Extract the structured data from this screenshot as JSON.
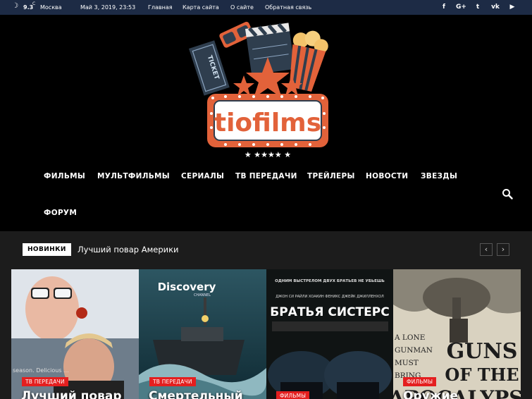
{
  "topbar": {
    "temperature": "9.3",
    "temp_unit": "C",
    "city": "Москва",
    "date": "Май 3, 2019, 23:53",
    "links": [
      "Главная",
      "Карта сайта",
      "О сайте",
      "Обратная связь"
    ],
    "social_icons": [
      "facebook-icon",
      "google-plus-icon",
      "twitter-icon",
      "vk-icon",
      "youtube-icon"
    ],
    "social_glyphs": [
      "f",
      "G+",
      "t",
      "vk",
      "▶"
    ]
  },
  "logo": {
    "text": "tiofilms",
    "ticket_text": "TICKET"
  },
  "menu": {
    "items": [
      "ФИЛЬМЫ",
      "МУЛЬТФИЛЬМЫ",
      "СЕРИАЛЫ",
      "ТВ ПЕРЕДАЧИ",
      "ТРЕЙЛЕРЫ",
      "НОВОСТИ",
      "ЗВЕЗДЫ",
      "ФОРУМ"
    ]
  },
  "ticker": {
    "badge": "НОВИНКИ",
    "headline": "Лучший повар Америки",
    "prev": "‹",
    "next": "›"
  },
  "cards": [
    {
      "category": "ТВ ПЕРЕДАЧИ",
      "title": "Лучший повар",
      "poster_text": "season. Delicious ..."
    },
    {
      "category": "ТВ ПЕРЕДАЧИ",
      "title": "Смертельный",
      "poster_brand": "Discovery",
      "poster_sub": "CHANNEL"
    },
    {
      "category": "ФИЛЬМЫ",
      "title": "",
      "poster_tagline": "ОДНИМ ВЫСТРЕЛОМ ДВУХ БРАТЬЕВ НЕ УБЬЕШЬ",
      "poster_actors": "ДЖОН СИ РАЙЛИ   ХОАКИН ФЕНИКС   ДЖЕЙК ДЖИЛЛЕНХОЛ",
      "poster_title": "БРАТЬЯ СИСТЕРС"
    },
    {
      "category": "ФИЛЬМЫ",
      "title": "Оружие",
      "poster_lines": [
        "A LONE",
        "GUNMAN",
        "MUST",
        "BRING"
      ],
      "poster_title_1": "GUNS",
      "poster_title_2": "OF THE",
      "poster_title_3": "APOCALYPSE"
    }
  ],
  "colors": {
    "topbar_bg": "#1d2b45",
    "accent_red": "#e41f1f",
    "logo_orange": "#e2623a"
  }
}
